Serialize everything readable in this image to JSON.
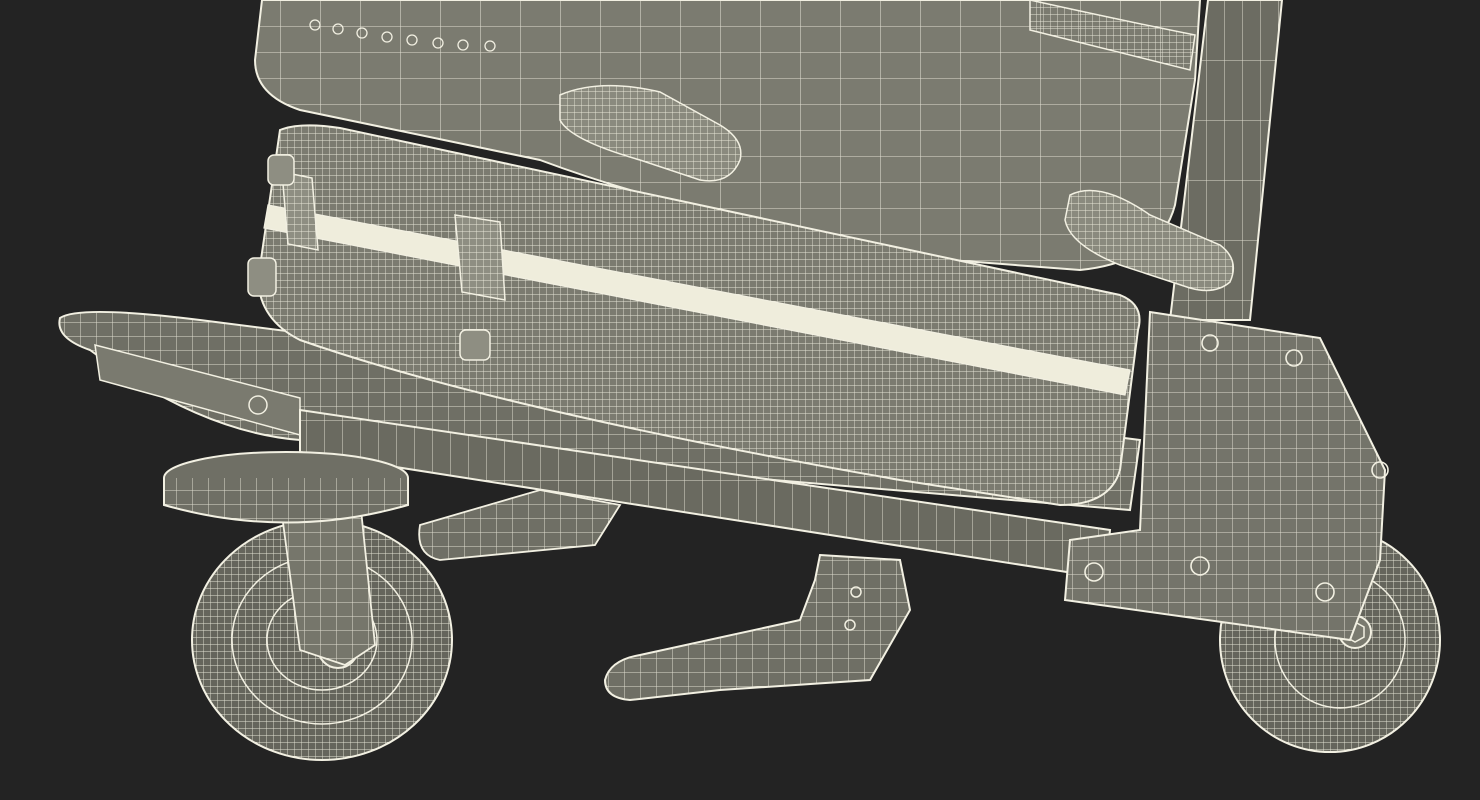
{
  "scene": {
    "background": "#232323",
    "surface": "#7b7b70",
    "surface_dark": "#5f5f56",
    "wire": "#f2f0e2",
    "band": "#efeddc"
  },
  "objects": [
    "luggage-cart",
    "upper-suitcase",
    "lower-suitcase",
    "front-caster-wheel",
    "rear-wheel",
    "kickstand-foot"
  ]
}
